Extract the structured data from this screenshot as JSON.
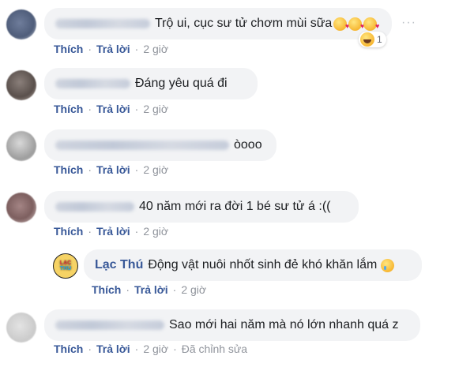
{
  "comments": [
    {
      "text": "Trộ ui, cục sư tử chơm mùi sữa",
      "like": "Thích",
      "reply": "Trả lời",
      "time": "2 giờ",
      "reaction_count": "1"
    },
    {
      "text": "Đáng yêu quá đi",
      "like": "Thích",
      "reply": "Trả lời",
      "time": "2 giờ"
    },
    {
      "text": "òooo",
      "like": "Thích",
      "reply": "Trả lời",
      "time": "2 giờ"
    },
    {
      "text": "40 năm mới ra đời 1 bé sư tử á :((",
      "like": "Thích",
      "reply": "Trả lời",
      "time": "2 giờ"
    },
    {
      "author": "Lạc Thú",
      "avatar_text": [
        "LẠC",
        "THÚ"
      ],
      "text": "Động vật nuôi nhốt sinh đẻ khó khăn lắm",
      "like": "Thích",
      "reply": "Trả lời",
      "time": "2 giờ"
    },
    {
      "text": "Sao mới hai năm mà nó lớn nhanh quá z",
      "like": "Thích",
      "reply": "Trả lời",
      "time": "2 giờ",
      "edited": "Đã chỉnh sửa"
    }
  ],
  "more_options": "···",
  "icons": {
    "heart_eyes_emoji": "smiling-face-with-hearts",
    "laugh_reaction": "laughing-face",
    "cry_emoji": "crying-face"
  },
  "colors": {
    "link": "#385898",
    "bubble": "#f2f3f5",
    "muted": "#90949c"
  }
}
